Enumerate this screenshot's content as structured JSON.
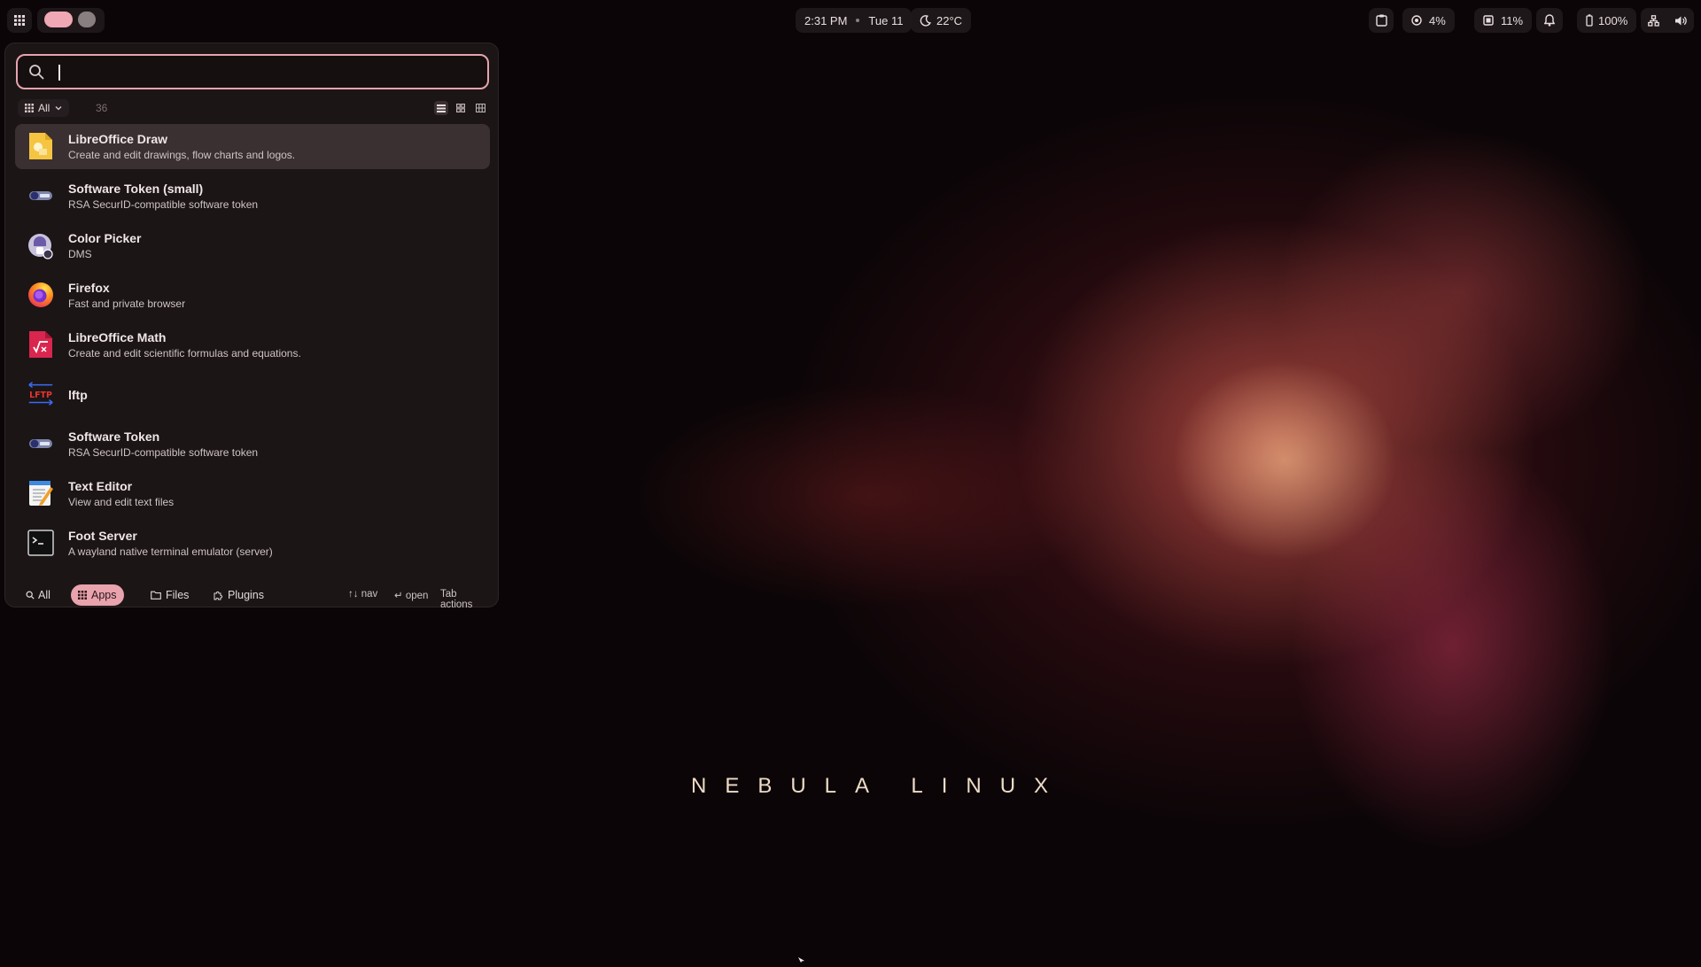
{
  "topbar": {
    "time": "2:31 PM",
    "date": "Tue 11",
    "weather": "22°C",
    "cpu": "4%",
    "memory": "11%",
    "battery": "100%",
    "accent": "#f0a8b4"
  },
  "launcher": {
    "search": {
      "value": "",
      "placeholder": ""
    },
    "filter_label": "All",
    "result_count": "36",
    "apps": [
      {
        "name": "LibreOffice Draw",
        "desc": "Create and edit drawings, flow charts and logos.",
        "icon": "libreoffice-draw-icon",
        "selected": true
      },
      {
        "name": "Software Token (small)",
        "desc": "RSA SecurID-compatible software token",
        "icon": "software-token-icon"
      },
      {
        "name": "Color Picker",
        "desc": "DMS",
        "icon": "color-picker-icon"
      },
      {
        "name": "Firefox",
        "desc": "Fast and private browser",
        "icon": "firefox-icon"
      },
      {
        "name": "LibreOffice Math",
        "desc": "Create and edit scientific formulas and equations.",
        "icon": "libreoffice-math-icon"
      },
      {
        "name": "lftp",
        "desc": "",
        "icon": "lftp-icon",
        "icon_text": "LFTP"
      },
      {
        "name": "Software Token",
        "desc": "RSA SecurID-compatible software token",
        "icon": "software-token-icon"
      },
      {
        "name": "Text Editor",
        "desc": "View and edit text files",
        "icon": "text-editor-icon"
      },
      {
        "name": "Foot Server",
        "desc": "A wayland native terminal emulator (server)",
        "icon": "terminal-icon"
      }
    ],
    "footer": {
      "tabs": [
        "All",
        "Apps",
        "Files",
        "Plugins"
      ],
      "active_tab": "Apps",
      "hint_nav": "↑↓ nav",
      "hint_open": "↵ open",
      "hint_actions": "Tab actions"
    }
  },
  "wallpaper": {
    "brand_text": "NEBULA LINUX"
  }
}
